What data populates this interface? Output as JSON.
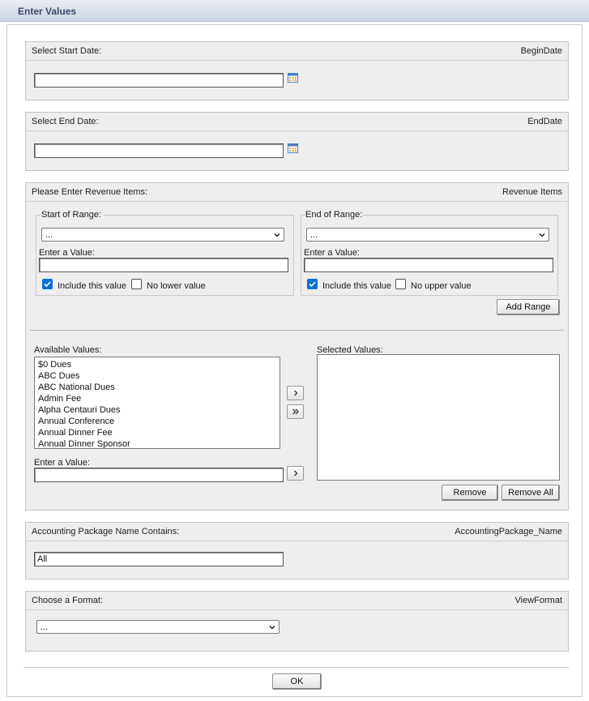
{
  "window": {
    "title": "Enter Values"
  },
  "begin_date": {
    "label": "Select Start Date:",
    "param": "BeginDate",
    "value": ""
  },
  "end_date": {
    "label": "Select End Date:",
    "param": "EndDate",
    "value": ""
  },
  "revenue": {
    "label": "Please Enter Revenue Items:",
    "param": "Revenue Items",
    "start": {
      "legend": "Start of Range:",
      "select_value": "...",
      "enter_label": "Enter a Value:",
      "value": "",
      "include_label": "Include this value",
      "include_checked": true,
      "no_bound_label": "No lower value",
      "no_bound_checked": false
    },
    "end": {
      "legend": "End of Range:",
      "select_value": "...",
      "enter_label": "Enter a Value:",
      "value": "",
      "include_label": "Include this value",
      "include_checked": true,
      "no_bound_label": "No upper value",
      "no_bound_checked": false
    },
    "add_range_label": "Add Range",
    "available_label": "Available Values:",
    "available_items": [
      "$0 Dues",
      "ABC Dues",
      "ABC National Dues",
      "Admin Fee",
      "Alpha Centauri Dues",
      "Annual Conference",
      "Annual Dinner Fee",
      "Annual Dinner Sponsor"
    ],
    "selected_label": "Selected Values:",
    "selected_items": [],
    "enter_label": "Enter a Value:",
    "enter_value": "",
    "remove_label": "Remove",
    "remove_all_label": "Remove All"
  },
  "accounting": {
    "label": "Accounting Package Name Contains:",
    "param": "AccountingPackage_Name",
    "value": "All"
  },
  "format": {
    "label": "Choose a Format:",
    "param": "ViewFormat",
    "select_value": "..."
  },
  "ok_label": "OK",
  "icons": {
    "calendar": "calendar-icon",
    "dropdown": "chevron-down-icon",
    "move_right": "chevron-right-icon",
    "move_all_right": "double-chevron-right-icon"
  },
  "colors": {
    "checkbox": "#0b6fd6",
    "title_text": "#3b4d6b"
  }
}
